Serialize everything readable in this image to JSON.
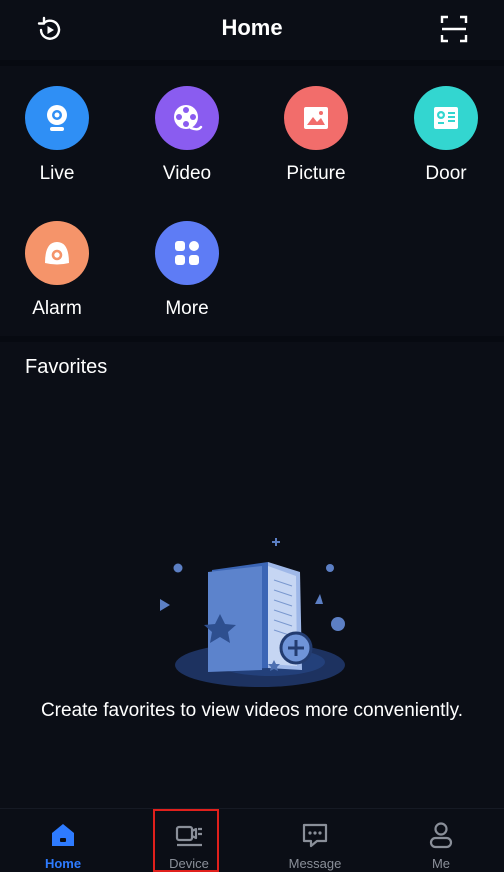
{
  "header": {
    "title": "Home",
    "left_icon": "playback-history-icon",
    "right_icon": "scan-icon"
  },
  "grid": [
    {
      "label": "Live",
      "icon": "camera-icon",
      "color": "#2f8ff5"
    },
    {
      "label": "Video",
      "icon": "film-reel-icon",
      "color": "#8a5cf0"
    },
    {
      "label": "Picture",
      "icon": "image-icon",
      "color": "#f26d6b"
    },
    {
      "label": "Door",
      "icon": "door-intercom-icon",
      "color": "#33d6d0"
    },
    {
      "label": "Alarm",
      "icon": "alarm-icon",
      "color": "#f5946a"
    },
    {
      "label": "More",
      "icon": "grid-apps-icon",
      "color": "#5e7cf5"
    }
  ],
  "favorites": {
    "title": "Favorites",
    "empty_message": "Create favorites to view videos more conveniently."
  },
  "bottom_nav": [
    {
      "label": "Home",
      "icon": "home-icon",
      "active": true
    },
    {
      "label": "Device",
      "icon": "device-camera-icon",
      "active": false
    },
    {
      "label": "Message",
      "icon": "message-icon",
      "active": false
    },
    {
      "label": "Me",
      "icon": "user-icon",
      "active": false
    }
  ],
  "colors": {
    "background": "#0b0e16",
    "accent": "#2e7bff",
    "inactive": "#8a8f99",
    "highlight": "#e0201c"
  }
}
